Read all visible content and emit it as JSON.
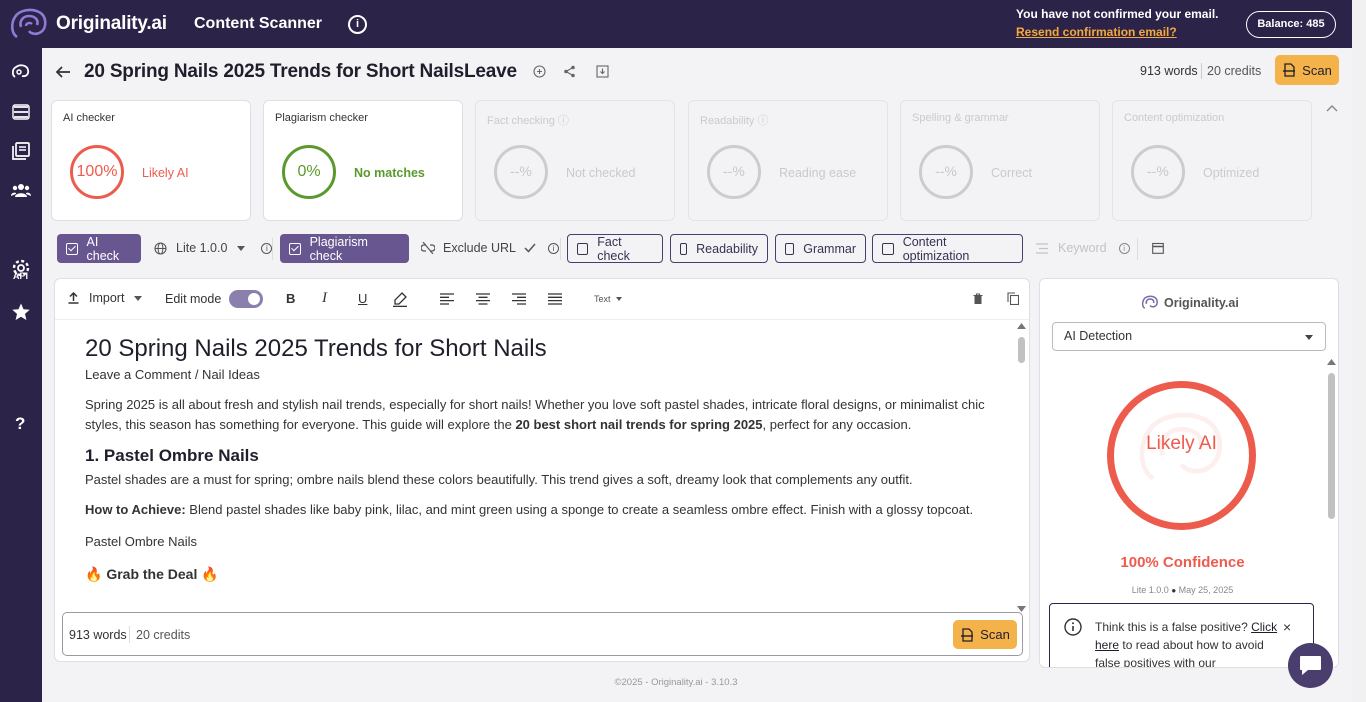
{
  "header": {
    "brand": "Originality.ai",
    "app_title": "Content Scanner",
    "info_glyph": "i",
    "email_msg": "You have not confirmed your email.",
    "email_link": "Resend confirmation email?",
    "balance": "Balance: 485"
  },
  "sidebar": {
    "icons": [
      "brain-icon",
      "scan-icon",
      "library-icon",
      "team-icon",
      "api-icon",
      "settings-icon",
      "star-icon",
      "help-icon"
    ],
    "api_label": "API",
    "help_label": "?"
  },
  "doc": {
    "title": "20 Spring Nails 2025 Trends for Short NailsLeave",
    "words": "913 words",
    "credits": "20 credits",
    "scan_label": "Scan"
  },
  "cards": [
    {
      "title": "AI checker",
      "value": "100%",
      "status": "Likely AI",
      "color": "#ed5b4d"
    },
    {
      "title": "Plagiarism checker",
      "value": "0%",
      "status": "No matches",
      "color": "#5a9a2d"
    },
    {
      "title": "Fact checking",
      "value": "--%",
      "status": "Not checked"
    },
    {
      "title": "Readability",
      "value": "--%",
      "status": "Reading ease"
    },
    {
      "title": "Spelling & grammar",
      "value": "--%",
      "status": "Correct"
    },
    {
      "title": "Content optimization",
      "value": "--%",
      "status": "Optimized"
    }
  ],
  "toolbar": {
    "ai_check": "AI check",
    "model": "Lite 1.0.0",
    "plagiarism_check": "Plagiarism check",
    "exclude_url": "Exclude URL",
    "fact_check": "Fact check",
    "readability": "Readability",
    "grammar": "Grammar",
    "content_opt": "Content optimization",
    "keyword": "Keyword"
  },
  "editor_toolbar": {
    "import": "Import",
    "edit_mode": "Edit mode",
    "text_style": "Text"
  },
  "content": {
    "h1": "20 Spring Nails 2025 Trends for Short Nails",
    "byline": "Leave a Comment / Nail Ideas",
    "intro_a": "Spring 2025 is all about fresh and stylish nail trends, especially for short nails! Whether you love soft pastel shades, intricate floral designs, or minimalist chic styles, this season has something for everyone. This guide will explore the ",
    "intro_bold": "20 best short nail trends for spring 2025",
    "intro_b": ", perfect for any occasion.",
    "h2": "1. Pastel Ombre Nails",
    "p1": "Pastel shades are a must for spring; ombre nails blend these colors beautifully. This trend gives a soft, dreamy look that complements any outfit.",
    "how_label": "How to Achieve:",
    "how_text": " Blend pastel shades like baby pink, lilac, and mint green using a sponge to create a seamless ombre effect. Finish with a glossy topcoat.",
    "caption": "Pastel Ombre Nails",
    "deal": "🔥 Grab the Deal 🔥"
  },
  "right_panel": {
    "logo": "Originality.ai",
    "select": "AI Detection",
    "result": "Likely AI",
    "confidence": "100% Confidence",
    "meta_model": "Lite 1.0.0",
    "meta_date": "May 25, 2025",
    "fp_text_a": "Think this is a false positive? ",
    "fp_link": "Click here",
    "fp_text_b": " to read about how to avoid false positives with our",
    "fp_close": "×"
  },
  "footer": {
    "copyright": "©2025 - Originality.ai - 3.10.3"
  }
}
